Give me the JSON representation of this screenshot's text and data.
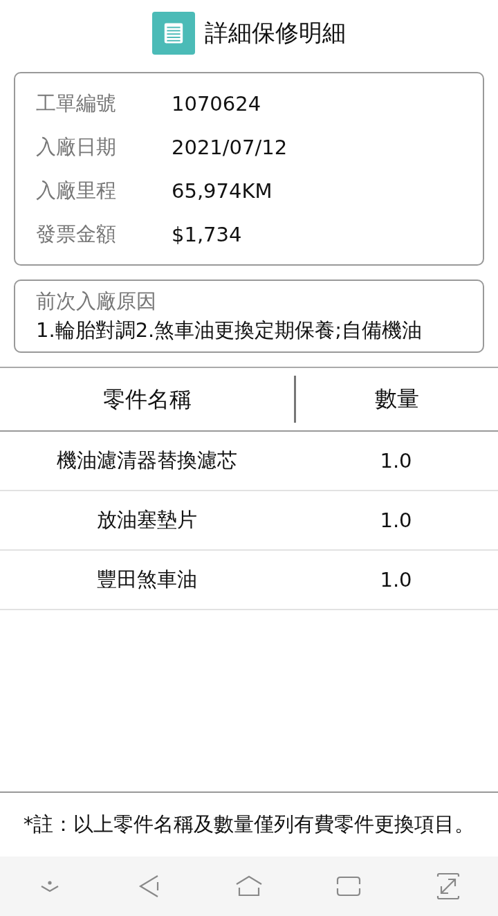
{
  "header": {
    "title": "詳細保修明細"
  },
  "info": [
    {
      "label": "工單編號",
      "value": "1070624"
    },
    {
      "label": "入廠日期",
      "value": "2021/07/12"
    },
    {
      "label": "入廠里程",
      "value": "65,974KM"
    },
    {
      "label": "發票金額",
      "value": "$1,734"
    }
  ],
  "reason": {
    "label": "前次入廠原因",
    "text": "1.輪胎對調2.煞車油更換定期保養;自備機油"
  },
  "table": {
    "columns": [
      "零件名稱",
      "數量"
    ],
    "rows": [
      {
        "name": "機油濾清器替換濾芯",
        "qty": "1.0"
      },
      {
        "name": "放油塞墊片",
        "qty": "1.0"
      },
      {
        "name": "豐田煞車油",
        "qty": "1.0"
      }
    ]
  },
  "note": "*註：以上零件名稱及數量僅列有費零件更換項目。",
  "nav_bar": [
    {
      "kind": "hide"
    },
    {
      "kind": "back"
    },
    {
      "kind": "home"
    },
    {
      "kind": "recent"
    },
    {
      "kind": "expand"
    }
  ]
}
